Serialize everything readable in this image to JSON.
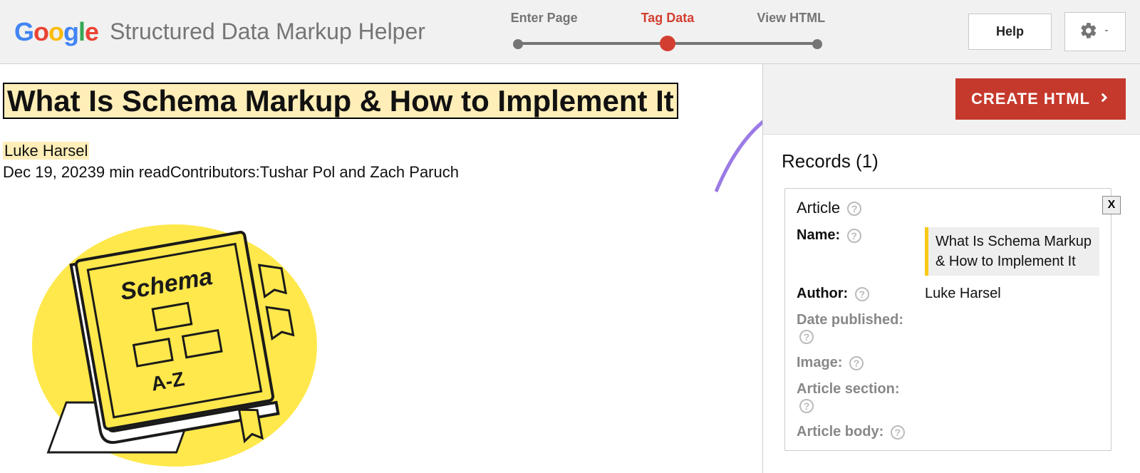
{
  "header": {
    "logo_text": "Google",
    "app_title": "Structured Data Markup Helper",
    "steps": {
      "step1": "Enter Page",
      "step2": "Tag Data",
      "step3": "View HTML",
      "active_index": 1
    },
    "help_label": "Help"
  },
  "preview": {
    "title": "What Is Schema Markup & How to Implement It",
    "author": "Luke Harsel",
    "meta_line": "Dec 19, 20239 min readContributors:Tushar Pol and Zach Paruch",
    "book": {
      "label_top": "Schema",
      "label_bottom": "A-Z"
    }
  },
  "sidebar": {
    "create_html_label": "CREATE HTML",
    "records_title": "Records (1)",
    "record": {
      "type": "Article",
      "close_label": "X",
      "fields": {
        "name": {
          "label": "Name:",
          "value": "What Is Schema Markup & How to Implement It"
        },
        "author": {
          "label": "Author:",
          "value": "Luke Harsel"
        },
        "date_published": {
          "label": "Date published:"
        },
        "image": {
          "label": "Image:"
        },
        "article_section": {
          "label": "Article section:"
        },
        "article_body": {
          "label": "Article body:"
        }
      }
    }
  }
}
